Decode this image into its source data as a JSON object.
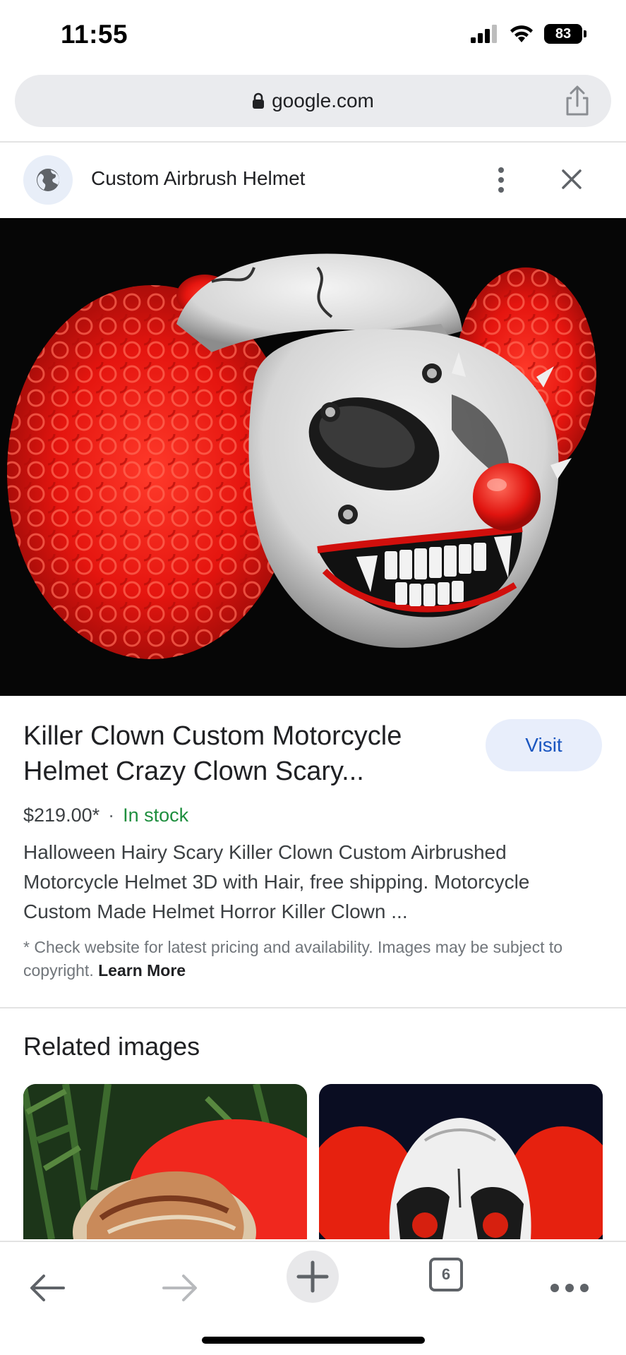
{
  "status_bar": {
    "time": "11:55",
    "battery": "83"
  },
  "address_bar": {
    "domain": "google.com"
  },
  "result_header": {
    "site_name": "Custom Airbrush Helmet"
  },
  "product": {
    "title": "Killer Clown Custom Motorcycle Helmet Crazy Clown Scary...",
    "visit_label": "Visit",
    "price": "$219.00*",
    "separator": "·",
    "stock": "In stock",
    "description": "Halloween Hairy Scary Killer Clown Custom Airbrushed Motorcycle Helmet 3D with Hair, free shipping. Motorcycle Custom Made Helmet Horror Killer Clown ...",
    "disclaimer": "* Check website for latest pricing and availability. Images may be subject to copyright.",
    "learn_more": "Learn More"
  },
  "related": {
    "title": "Related images"
  },
  "toolbar": {
    "tab_count": "6"
  },
  "colors": {
    "visit_bg": "#e8eefb",
    "visit_text": "#1a56c0",
    "stock_green": "#1e8e3e",
    "address_bg": "#eaebee"
  },
  "icons": {
    "signal": "signal-icon",
    "wifi": "wifi-icon",
    "battery": "battery-icon",
    "lock": "lock-icon",
    "share": "share-icon",
    "globe": "globe-icon",
    "more": "more-vert-icon",
    "close": "close-icon",
    "back": "back-arrow-icon",
    "forward": "forward-arrow-icon",
    "new_tab": "plus-icon",
    "tabs": "tabs-icon",
    "menu": "more-horiz-icon"
  }
}
